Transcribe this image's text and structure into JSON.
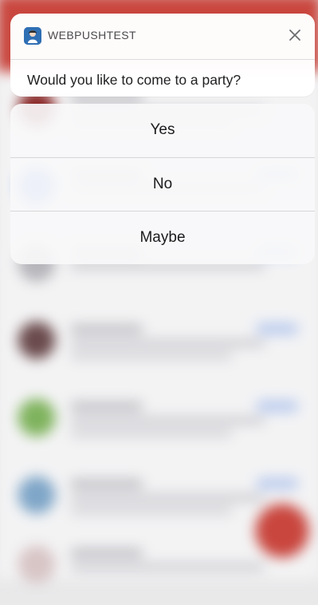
{
  "notification": {
    "app_name": "WEBPUSHTEST",
    "message": "Would you like to come to a party?",
    "close_glyph": "✕"
  },
  "actions": [
    {
      "label": "Yes"
    },
    {
      "label": "No"
    },
    {
      "label": "Maybe"
    }
  ],
  "colors": {
    "background_appbar": "#c9463e",
    "fab": "#c9463e",
    "app_icon": "#2f6fb4"
  }
}
